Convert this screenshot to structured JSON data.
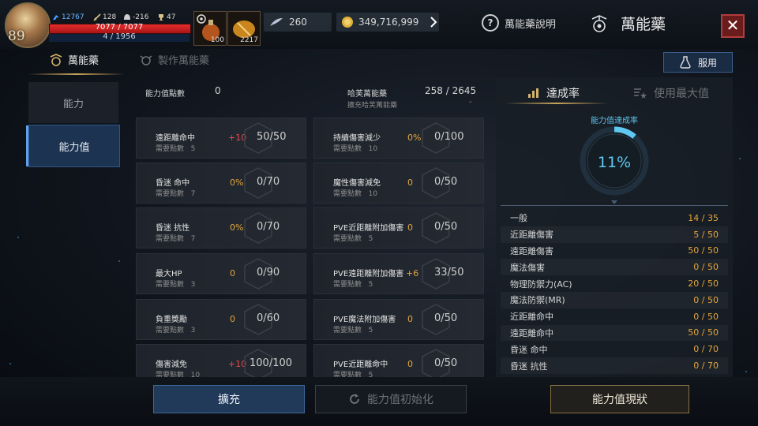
{
  "player": {
    "level": "89",
    "stat_blue": "12767",
    "stat_attack": "128",
    "stat_helmet": "-216",
    "stat_trophy": "47",
    "hp_text": "7077 / 7077",
    "mp_text": "4 / 1956",
    "hp_fraction": 1.0,
    "mp_fraction": 0.002
  },
  "slots": [
    {
      "name": "potion-slot-1",
      "count": "100"
    },
    {
      "name": "potion-slot-2",
      "count": "2217"
    }
  ],
  "resources": {
    "diamond": "260",
    "gold": "349,716,999"
  },
  "header": {
    "help_label": "萬能藥說明",
    "title": "萬能藥",
    "close": "✕"
  },
  "tabs": {
    "panacea": "萬能藥",
    "craft": "製作萬能藥",
    "use_label": "服用"
  },
  "left_menu": {
    "ability": "能力",
    "ability_value": "能力值"
  },
  "summary": {
    "points_label": "能力值點數",
    "points_value": "0",
    "book_label": "哈芙萬能藥",
    "book_value": "258 / 2645",
    "expand_label": "擴充哈芙萬能藥",
    "expand_value": "-"
  },
  "cards_left": [
    {
      "name": "遠距離命中",
      "cost_label": "需要點數",
      "cost": "5",
      "bonus": "+10",
      "value": "50/50",
      "bonus_color": "#e84a4a"
    },
    {
      "name": "昏迷 命中",
      "cost_label": "需要點數",
      "cost": "7",
      "bonus": "0%",
      "value": "0/70",
      "bonus_color": "#e3a53c"
    },
    {
      "name": "昏迷 抗性",
      "cost_label": "需要點數",
      "cost": "7",
      "bonus": "0%",
      "value": "0/70",
      "bonus_color": "#e3a53c"
    },
    {
      "name": "最大HP",
      "cost_label": "需要點數",
      "cost": "3",
      "bonus": "0",
      "value": "0/90",
      "bonus_color": "#e3a53c"
    },
    {
      "name": "負重獎勵",
      "cost_label": "需要點數",
      "cost": "3",
      "bonus": "0",
      "value": "0/60",
      "bonus_color": "#e3a53c"
    },
    {
      "name": "傷害減免",
      "cost_label": "需要點數",
      "cost": "10",
      "bonus": "+10",
      "value": "100/100",
      "bonus_color": "#e84a4a"
    }
  ],
  "cards_right": [
    {
      "name": "持續傷害減少",
      "cost_label": "需要點數",
      "cost": "10",
      "bonus": "0%",
      "value": "0/100",
      "bonus_color": "#e3a53c"
    },
    {
      "name": "魔性傷害減免",
      "cost_label": "需要點數",
      "cost": "10",
      "bonus": "0",
      "value": "0/50",
      "bonus_color": "#e3a53c"
    },
    {
      "name": "PVE近距離附加傷害",
      "cost_label": "需要點數",
      "cost": "5",
      "bonus": "0",
      "value": "0/50",
      "bonus_color": "#e3a53c"
    },
    {
      "name": "PVE遠距離附加傷害",
      "cost_label": "需要點數",
      "cost": "5",
      "bonus": "+6",
      "value": "33/50",
      "bonus_color": "#e3a53c"
    },
    {
      "name": "PVE魔法附加傷害",
      "cost_label": "需要點數",
      "cost": "5",
      "bonus": "0",
      "value": "0/50",
      "bonus_color": "#e3a53c"
    },
    {
      "name": "PVE近距離命中",
      "cost_label": "需要點數",
      "cost": "5",
      "bonus": "0",
      "value": "0/50",
      "bonus_color": "#e3a53c"
    }
  ],
  "right_panel": {
    "tab_rate": "達成率",
    "tab_max": "使用最大值",
    "gauge_label": "能力值達成率",
    "gauge_value": "11%",
    "gauge_fraction": 0.11,
    "rows": [
      {
        "label": "一般",
        "value": "14 / 35"
      },
      {
        "label": "近距離傷害",
        "value": "5 / 50"
      },
      {
        "label": "遠距離傷害",
        "value": "50 / 50"
      },
      {
        "label": "魔法傷害",
        "value": "0 / 50"
      },
      {
        "label": "物理防禦力(AC)",
        "value": "20 / 50"
      },
      {
        "label": "魔法防禦(MR)",
        "value": "0 / 50"
      },
      {
        "label": "近距離命中",
        "value": "0 / 50"
      },
      {
        "label": "遠距離命中",
        "value": "50 / 50"
      },
      {
        "label": "昏迷 命中",
        "value": "0 / 70"
      },
      {
        "label": "昏迷 抗性",
        "value": "0 / 70"
      }
    ]
  },
  "bottom": {
    "expand": "擴充",
    "reset": "能力值初始化",
    "status": "能力值現狀"
  }
}
